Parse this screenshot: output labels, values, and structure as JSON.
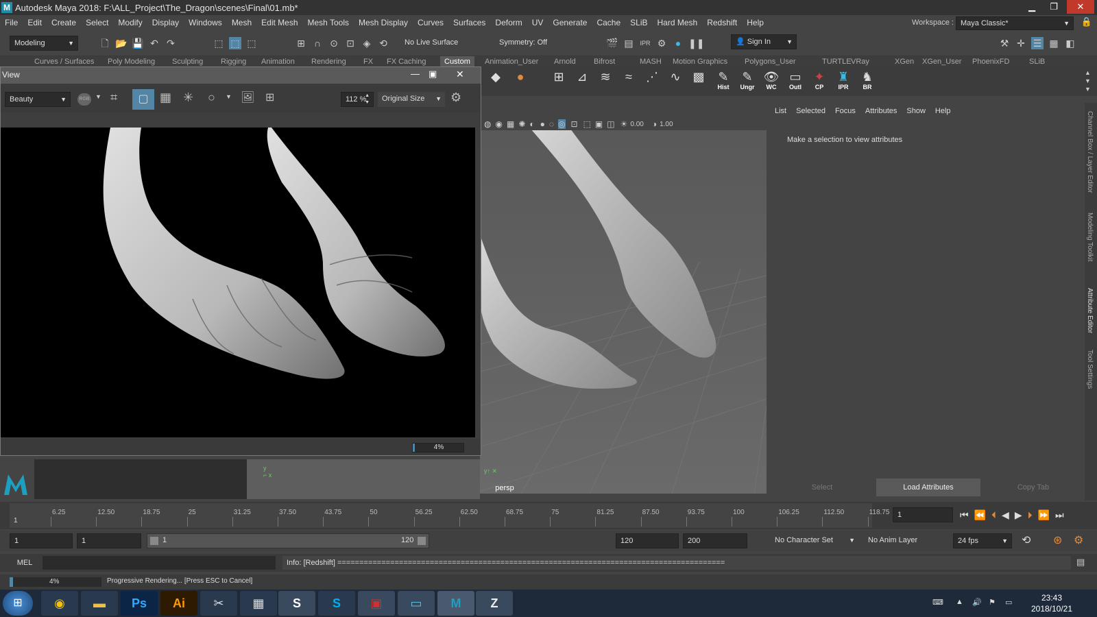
{
  "window": {
    "title": "Autodesk Maya 2018: F:\\ALL_Project\\The_Dragon\\scenes\\Final\\01.mb*",
    "logo_letter": "M"
  },
  "menu": [
    "File",
    "Edit",
    "Create",
    "Select",
    "Modify",
    "Display",
    "Windows",
    "Mesh",
    "Edit Mesh",
    "Mesh Tools",
    "Mesh Display",
    "Curves",
    "Surfaces",
    "Deform",
    "UV",
    "Generate",
    "Cache",
    "SLiB",
    "Hard Mesh",
    "Redshift",
    "Help"
  ],
  "workspace": {
    "label": "Workspace :",
    "value": "Maya Classic*"
  },
  "toolbar": {
    "mode": "Modeling",
    "live_surface": "No Live Surface",
    "symmetry": "Symmetry: Off",
    "sign_in": "Sign In"
  },
  "shelf_tabs": [
    "Curves / Surfaces",
    "Poly Modeling",
    "Sculpting",
    "Rigging",
    "Animation",
    "Rendering",
    "FX",
    "FX Caching",
    "Custom",
    "Animation_User",
    "Arnold",
    "Bifrost",
    "MASH",
    "Motion Graphics",
    "Polygons_User",
    "TURTLE",
    "VRay",
    "XGen",
    "XGen_User",
    "PhoenixFD",
    "SLiB"
  ],
  "shelf_active": "Custom",
  "shelf_labeled": [
    "Hist",
    "Ungr",
    "WC",
    "Outl",
    "CP",
    "IPR",
    "BR"
  ],
  "render_view": {
    "title": "View",
    "aov": "Beauty",
    "channel": "RGB",
    "zoom": "112 %",
    "size": "Original Size",
    "progress": "4%",
    "progress_value": 0.04
  },
  "viewport": {
    "camera": "persp",
    "field1": "0.00",
    "field2": "1.00"
  },
  "attribute_editor": {
    "menu": [
      "List",
      "Selected",
      "Focus",
      "Attributes",
      "Show",
      "Help"
    ],
    "message": "Make a selection to view attributes",
    "buttons": {
      "select": "Select",
      "load": "Load Attributes",
      "copy": "Copy Tab"
    }
  },
  "side_tabs": [
    "Channel Box / Layer Editor",
    "Modeling Toolkit",
    "Attribute Editor",
    "Tool Settings"
  ],
  "timeline": {
    "ticks": [
      "6.25",
      "12.50",
      "18.75",
      "25",
      "31.25",
      "37.50",
      "43.75",
      "50",
      "56.25",
      "62.50",
      "68.75",
      "75",
      "81.25",
      "87.50",
      "93.75",
      "100",
      "106.25",
      "112.50",
      "118.75"
    ],
    "start_label": "1",
    "current_frame": "1"
  },
  "range": {
    "start": "1",
    "playback_start": "1",
    "slider_start": "1",
    "slider_end": "120",
    "playback_end": "120",
    "end": "200",
    "character_set": "No Character Set",
    "anim_layer": "No Anim Layer",
    "fps": "24 fps"
  },
  "command": {
    "lang": "MEL",
    "output": "Info: [Redshift] ========================================================================================"
  },
  "help": {
    "progress": "4%",
    "message": "Progressive Rendering... [Press ESC to Cancel]"
  },
  "taskbar": {
    "time": "23:43",
    "date": "2018/10/21"
  },
  "colors": {
    "accent": "#5285a6",
    "shelf_active": "#5a5a5a"
  }
}
